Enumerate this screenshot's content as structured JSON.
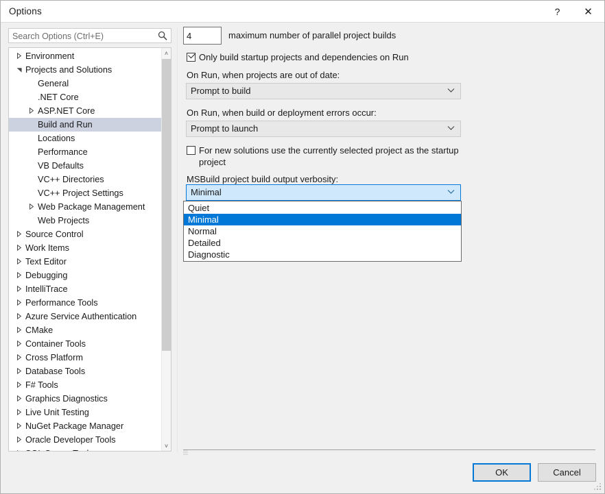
{
  "window": {
    "title": "Options",
    "help_label": "?",
    "close_label": "✕"
  },
  "search": {
    "placeholder": "Search Options (Ctrl+E)",
    "value": "",
    "icon": "search-icon"
  },
  "tree": {
    "items": [
      {
        "label": "Environment",
        "level": 0,
        "expander": "collapsed",
        "selected": false
      },
      {
        "label": "Projects and Solutions",
        "level": 0,
        "expander": "expanded",
        "selected": false
      },
      {
        "label": "General",
        "level": 1,
        "expander": "none",
        "selected": false
      },
      {
        "label": ".NET Core",
        "level": 1,
        "expander": "none",
        "selected": false
      },
      {
        "label": "ASP.NET Core",
        "level": 1,
        "expander": "collapsed",
        "selected": false
      },
      {
        "label": "Build and Run",
        "level": 1,
        "expander": "none",
        "selected": true
      },
      {
        "label": "Locations",
        "level": 1,
        "expander": "none",
        "selected": false
      },
      {
        "label": "Performance",
        "level": 1,
        "expander": "none",
        "selected": false
      },
      {
        "label": "VB Defaults",
        "level": 1,
        "expander": "none",
        "selected": false
      },
      {
        "label": "VC++ Directories",
        "level": 1,
        "expander": "none",
        "selected": false
      },
      {
        "label": "VC++ Project Settings",
        "level": 1,
        "expander": "none",
        "selected": false
      },
      {
        "label": "Web Package Management",
        "level": 1,
        "expander": "collapsed",
        "selected": false
      },
      {
        "label": "Web Projects",
        "level": 1,
        "expander": "none",
        "selected": false
      },
      {
        "label": "Source Control",
        "level": 0,
        "expander": "collapsed",
        "selected": false
      },
      {
        "label": "Work Items",
        "level": 0,
        "expander": "collapsed",
        "selected": false
      },
      {
        "label": "Text Editor",
        "level": 0,
        "expander": "collapsed",
        "selected": false
      },
      {
        "label": "Debugging",
        "level": 0,
        "expander": "collapsed",
        "selected": false
      },
      {
        "label": "IntelliTrace",
        "level": 0,
        "expander": "collapsed",
        "selected": false
      },
      {
        "label": "Performance Tools",
        "level": 0,
        "expander": "collapsed",
        "selected": false
      },
      {
        "label": "Azure Service Authentication",
        "level": 0,
        "expander": "collapsed",
        "selected": false
      },
      {
        "label": "CMake",
        "level": 0,
        "expander": "collapsed",
        "selected": false
      },
      {
        "label": "Container Tools",
        "level": 0,
        "expander": "collapsed",
        "selected": false
      },
      {
        "label": "Cross Platform",
        "level": 0,
        "expander": "collapsed",
        "selected": false
      },
      {
        "label": "Database Tools",
        "level": 0,
        "expander": "collapsed",
        "selected": false
      },
      {
        "label": "F# Tools",
        "level": 0,
        "expander": "collapsed",
        "selected": false
      },
      {
        "label": "Graphics Diagnostics",
        "level": 0,
        "expander": "collapsed",
        "selected": false
      },
      {
        "label": "Live Unit Testing",
        "level": 0,
        "expander": "collapsed",
        "selected": false
      },
      {
        "label": "NuGet Package Manager",
        "level": 0,
        "expander": "collapsed",
        "selected": false
      },
      {
        "label": "Oracle Developer Tools",
        "level": 0,
        "expander": "collapsed",
        "selected": false
      },
      {
        "label": "SQL Server Tools",
        "level": 0,
        "expander": "collapsed",
        "selected": false
      }
    ],
    "scrollbar": {
      "up_arrow": "˄",
      "down_arrow": "˅"
    }
  },
  "main": {
    "parallel_builds": {
      "value": "4",
      "label": "maximum number of parallel project builds"
    },
    "only_build_startup": {
      "label": "Only build startup projects and dependencies on Run",
      "checked": true
    },
    "out_of_date": {
      "label": "On Run, when projects are out of date:",
      "value": "Prompt to build"
    },
    "errors_occur": {
      "label": "On Run, when build or deployment errors occur:",
      "value": "Prompt to launch"
    },
    "new_solutions_startup": {
      "label": "For new solutions use the currently selected project as the startup project",
      "checked": false
    },
    "verbosity": {
      "label": "MSBuild project build output verbosity:",
      "value": "Minimal",
      "options": [
        "Quiet",
        "Minimal",
        "Normal",
        "Detailed",
        "Diagnostic"
      ],
      "selected_index": 1
    },
    "combo_arrow": "⌄"
  },
  "footer": {
    "ok_label": "OK",
    "cancel_label": "Cancel"
  },
  "colors": {
    "accent": "#0078d7",
    "selection_bg": "#0078d7",
    "tree_selection_bg": "#cdd2e1",
    "combo_open_bg": "#cfe8fb",
    "dialog_bg": "#f0f0f0"
  }
}
